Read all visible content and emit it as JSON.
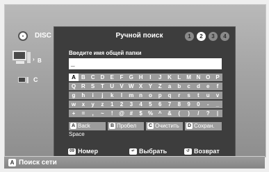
{
  "side_menu": {
    "items": [
      {
        "label": "DISC",
        "icon": "disc-icon"
      },
      {
        "label": "B",
        "icon": "pc-icon"
      },
      {
        "label": "C",
        "icon": "pc-icon"
      }
    ]
  },
  "dialog": {
    "title": "Ручной поиск",
    "steps": [
      "1",
      "2",
      "3",
      "4"
    ],
    "active_step": "2",
    "prompt": "Введите имя общей папки",
    "input_value": "_",
    "keyboard_rows": [
      [
        "A",
        "B",
        "C",
        "D",
        "E",
        "F",
        "G",
        "H",
        "I",
        "J",
        "K",
        "L",
        "M",
        "N",
        "O",
        "P"
      ],
      [
        "Q",
        "R",
        "S",
        "T",
        "U",
        "V",
        "W",
        "X",
        "Y",
        "Z",
        "a",
        "b",
        "c",
        "d",
        "e",
        "f"
      ],
      [
        "g",
        "h",
        "i",
        "j",
        "k",
        "l",
        "m",
        "n",
        "o",
        "p",
        "q",
        "r",
        "s",
        "t",
        "u",
        "v"
      ],
      [
        "w",
        "x",
        "y",
        "z",
        "1",
        "2",
        "3",
        "4",
        "5",
        "6",
        "7",
        "8",
        "9",
        "0",
        "-",
        "_"
      ],
      [
        "+",
        "=",
        ",",
        "~",
        "!",
        "@",
        "#",
        "$",
        "%",
        "^",
        "&",
        "(",
        ")",
        "/",
        "?",
        "|"
      ]
    ],
    "selected_key": "A",
    "functions": [
      {
        "key": "A",
        "label": "Back Space"
      },
      {
        "key": "B",
        "label": "Пробел"
      },
      {
        "key": "C",
        "label": "Очистить"
      },
      {
        "key": "D",
        "label": "Сохран."
      }
    ],
    "footer": [
      {
        "icon": "number-icon",
        "label": "Номер"
      },
      {
        "icon": "enter-icon",
        "label": "Выбрать"
      },
      {
        "icon": "return-icon",
        "label": "Возврат"
      }
    ]
  },
  "bottom_bar": {
    "key": "A",
    "label": "Поиск сети"
  },
  "colors": {
    "dialog_bg": "#3d3d3d",
    "key_bg": "#9c9c9c",
    "selected_key_bg": "#ffffff"
  }
}
